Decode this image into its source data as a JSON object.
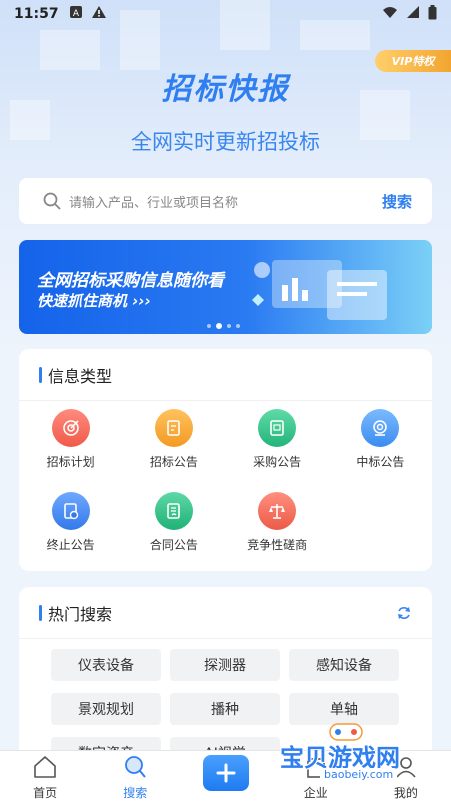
{
  "statusbar": {
    "time": "11:57"
  },
  "vip_badge": "VIP特权",
  "hero": {
    "title": "招标快报",
    "subtitle": "全网实时更新招投标"
  },
  "search": {
    "placeholder": "请输入产品、行业或项目名称",
    "button": "搜索"
  },
  "banner": {
    "line1": "全网招标采购信息随你看",
    "line2": "快速抓住商机 ›››"
  },
  "info_types": {
    "title": "信息类型",
    "items": [
      {
        "label": "招标计划",
        "color": "#f26b5b"
      },
      {
        "label": "招标公告",
        "color": "#f7a93a"
      },
      {
        "label": "采购公告",
        "color": "#39c48a"
      },
      {
        "label": "中标公告",
        "color": "#4b9df5"
      },
      {
        "label": "终止公告",
        "color": "#4b8ff2"
      },
      {
        "label": "合同公告",
        "color": "#33c089"
      },
      {
        "label": "竞争性磋商",
        "color": "#f2705d"
      }
    ]
  },
  "hot_search": {
    "title": "热门搜索",
    "tags": [
      "仪表设备",
      "探测器",
      "感知设备",
      "景观规划",
      "播种",
      "单轴",
      "数字资产",
      "AI视觉",
      ""
    ]
  },
  "tabbar": {
    "items": [
      "首页",
      "搜索",
      "",
      "企业",
      "我的"
    ]
  },
  "watermark": {
    "text": "宝贝游戏网",
    "url": "baobeiy.com"
  }
}
